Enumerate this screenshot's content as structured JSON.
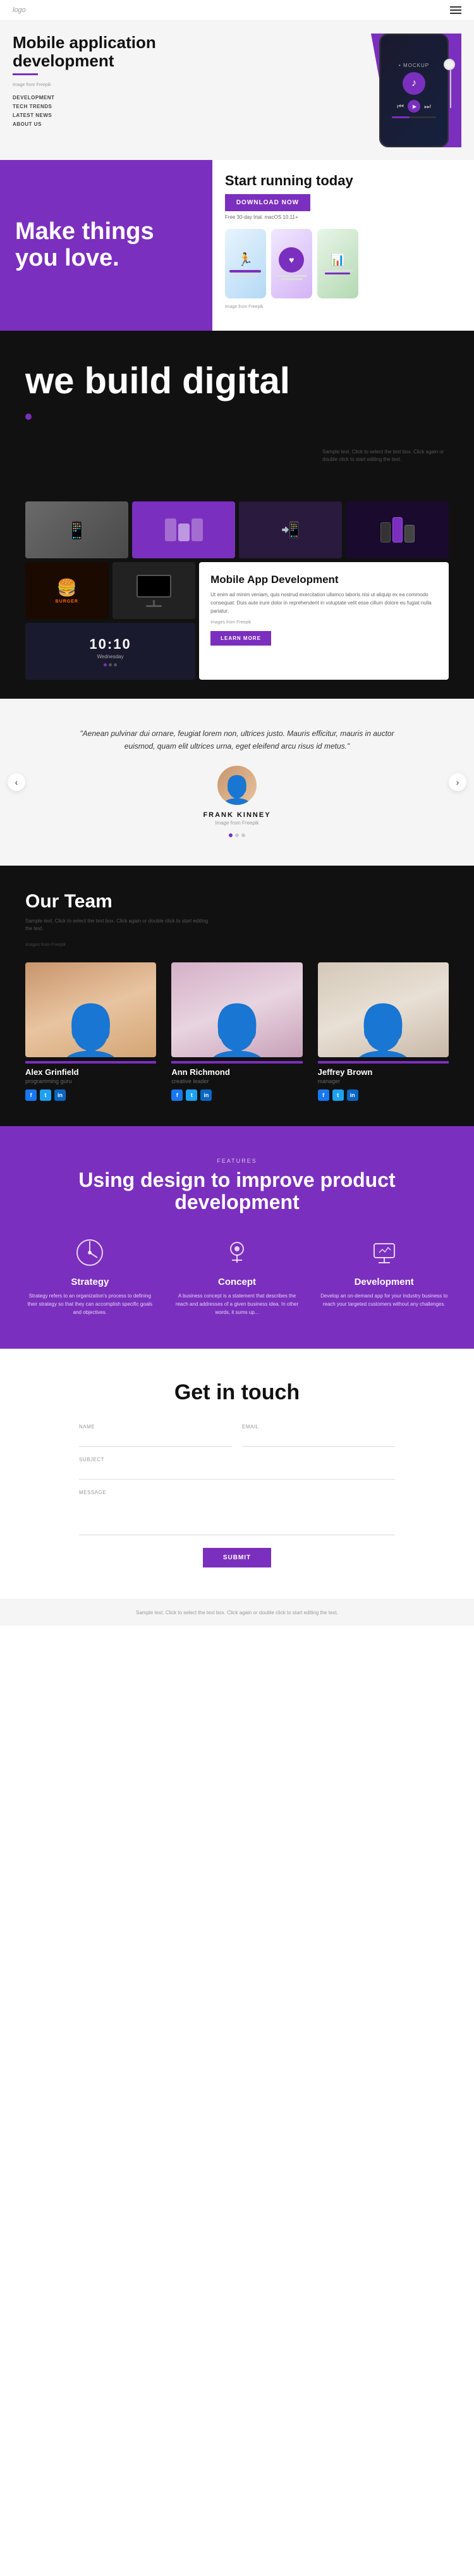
{
  "header": {
    "logo": "logo",
    "menu_icon": "≡"
  },
  "hero": {
    "title": "Mobile application development",
    "subtitle": "Image from Freepik",
    "mockup_label": "MOCKUP",
    "nav": [
      "DEVELOPMENT",
      "TECH TRENDS",
      "LATEST NEWS",
      "ABOUT US"
    ]
  },
  "section2": {
    "left_text": "Make things you love.",
    "right_title": "Start running today",
    "download_btn": "DOWNLOAD NOW",
    "trial_text": "Free 30-day trial. macOS 10.11+",
    "image_credit": "Image from Freepik"
  },
  "section3": {
    "title": "we build digital",
    "description": "Sample text. Click to select the text box. Click again or double click to start editing the text."
  },
  "portfolio": {
    "card_title": "Mobile App Development",
    "card_desc": "Ut enim ad minim veniam, quis nostrud exercitation ullamco laboris nisi ut aliquip ex ea commodo consequat. Duis aute irure dolor in reprehenderit in voluptate velit esse cillum dolore eu fugiat nulla pariatur.",
    "card_image_credit": "Images from Freepik",
    "learn_more": "LEARN MORE"
  },
  "testimonial": {
    "quote": "\"Aenean pulvinar dui ornare, feugiat lorem non, ultrices justo. Mauris efficitur, mauris in auctor euismod, quam elit ultrices urna, eget eleifend arcu risus id metus.\"",
    "name": "FRANK KINNEY",
    "source": "Image from Freepik"
  },
  "team": {
    "title": "Our Team",
    "description": "Sample text. Click to select the text box. Click again or double click to start editing the text.",
    "images_credit": "Images from Freepik",
    "members": [
      {
        "name": "Alex Grinfield",
        "role": "programming guru",
        "social": [
          "f",
          "t",
          "in"
        ]
      },
      {
        "name": "Ann Richmond",
        "role": "creative leader",
        "social": [
          "f",
          "t",
          "in"
        ]
      },
      {
        "name": "Jeffrey Brown",
        "role": "manager",
        "social": [
          "f",
          "t",
          "in"
        ]
      }
    ]
  },
  "features": {
    "label": "FEATURES",
    "title": "Using design to improve product development",
    "items": [
      {
        "name": "Strategy",
        "desc": "Strategy refers to an organization's process to defining their strategy so that they can accomplish specific goals and objectives."
      },
      {
        "name": "Concept",
        "desc": "A business concept is a statement that describes the reach and addresses of a given business idea. In other words, it sums up..."
      },
      {
        "name": "Development",
        "desc": "Develop an on-demand app for your industry business to reach your targeted customers without any challenges."
      }
    ]
  },
  "contact": {
    "title": "Get in touch",
    "fields": {
      "name_label": "NAME",
      "email_label": "EMAIL",
      "subject_label": "SUBJECT",
      "message_label": "MESSAGE",
      "name_placeholder": "",
      "email_placeholder": "",
      "subject_placeholder": "",
      "message_placeholder": ""
    },
    "submit_btn": "SUBMIT"
  },
  "footer": {
    "text": "Sample text. Click to select the text box. Click again or double click to start editing the text."
  }
}
